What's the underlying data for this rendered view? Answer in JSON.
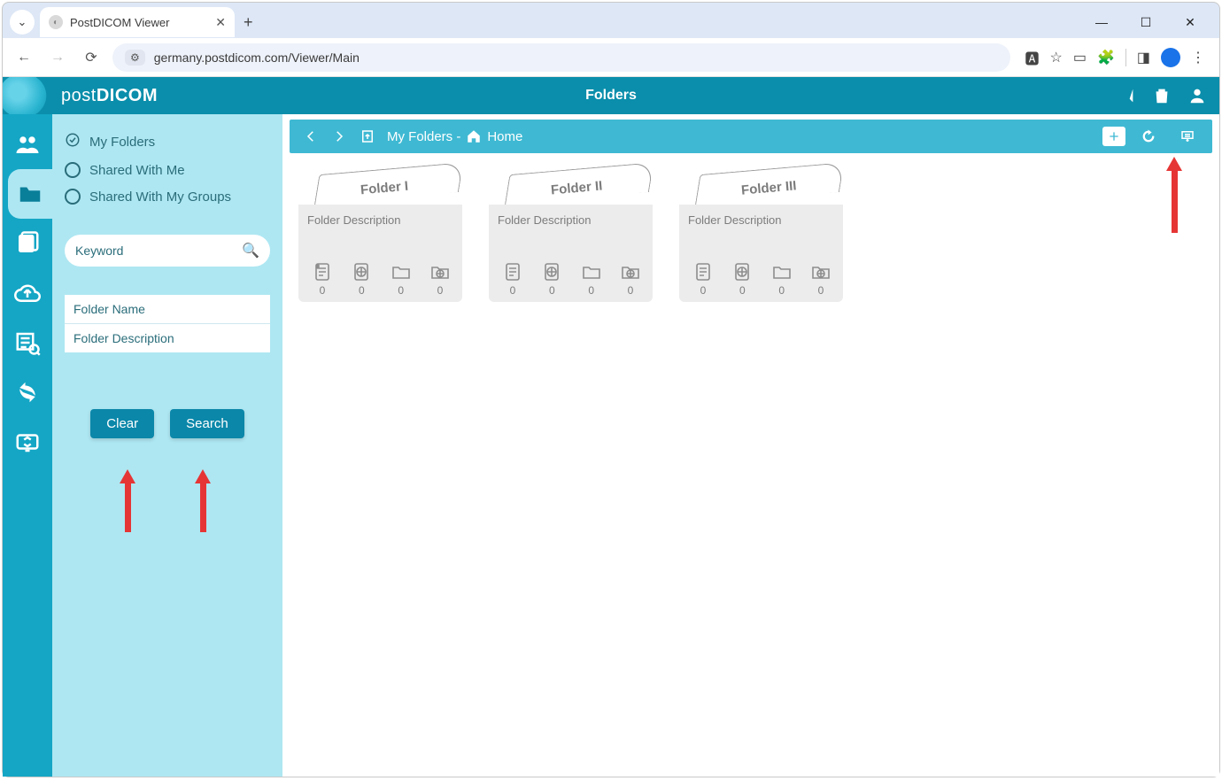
{
  "browser": {
    "tab_title": "PostDICOM Viewer",
    "url": "germany.postdicom.com/Viewer/Main"
  },
  "header": {
    "brand_pre": "post",
    "brand_bold": "DICOM",
    "title": "Folders"
  },
  "sidebar": {
    "radios": [
      {
        "label": "My Folders",
        "selected": true
      },
      {
        "label": "Shared With Me",
        "selected": false
      },
      {
        "label": "Shared With My Groups",
        "selected": false
      }
    ],
    "keyword_placeholder": "Keyword",
    "folder_name_placeholder": "Folder Name",
    "folder_desc_placeholder": "Folder Description",
    "clear_label": "Clear",
    "search_label": "Search"
  },
  "crumb": {
    "prefix": "My Folders - ",
    "home": "Home"
  },
  "folders": [
    {
      "name": "Folder I",
      "desc": "Folder Description",
      "counts": [
        "0",
        "0",
        "0",
        "0"
      ]
    },
    {
      "name": "Folder II",
      "desc": "Folder Description",
      "counts": [
        "0",
        "0",
        "0",
        "0"
      ]
    },
    {
      "name": "Folder III",
      "desc": "Folder Description",
      "counts": [
        "0",
        "0",
        "0",
        "0"
      ]
    }
  ]
}
